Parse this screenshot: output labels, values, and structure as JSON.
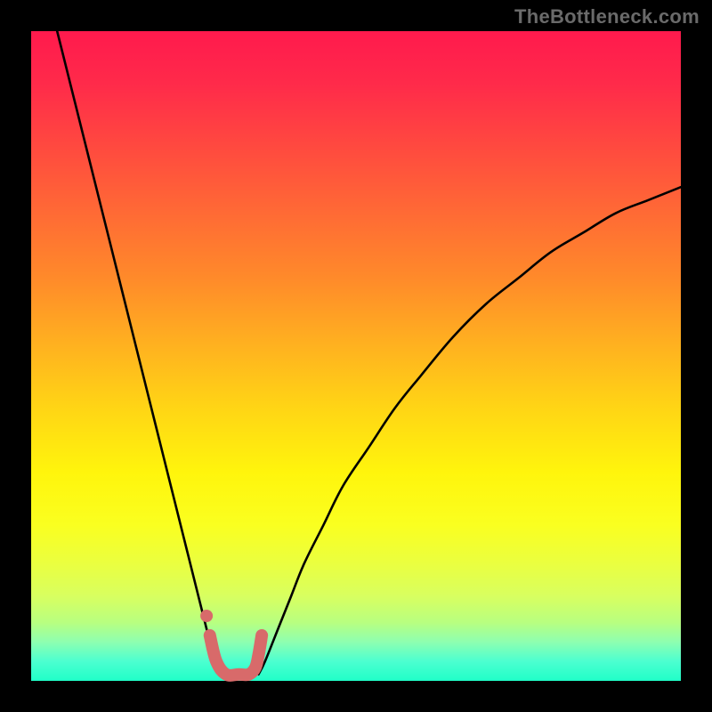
{
  "watermark": "TheBottleneck.com",
  "colors": {
    "frame": "#000000",
    "curve": "#000000",
    "marker": "#d86a6a",
    "gradient_top": "#ff1a4d",
    "gradient_bottom": "#20ffc8"
  },
  "chart_data": {
    "type": "line",
    "title": "",
    "xlabel": "",
    "ylabel": "",
    "xlim": [
      0,
      100
    ],
    "ylim": [
      0,
      100
    ],
    "series": [
      {
        "name": "left-curve",
        "x": [
          4,
          6,
          8,
          10,
          12,
          14,
          16,
          18,
          20,
          22,
          24,
          26,
          27,
          28,
          29
        ],
        "y": [
          100,
          92,
          84,
          76,
          68,
          60,
          52,
          44,
          36,
          28,
          20,
          12,
          8,
          4,
          1
        ]
      },
      {
        "name": "right-curve",
        "x": [
          35,
          36,
          38,
          40,
          42,
          45,
          48,
          52,
          56,
          60,
          65,
          70,
          75,
          80,
          85,
          90,
          95,
          100
        ],
        "y": [
          1,
          3,
          8,
          13,
          18,
          24,
          30,
          36,
          42,
          47,
          53,
          58,
          62,
          66,
          69,
          72,
          74,
          76
        ]
      },
      {
        "name": "marker-segment",
        "x": [
          27.5,
          28.5,
          30,
          32,
          33.5,
          34.5,
          35,
          35.5
        ],
        "y": [
          7,
          3,
          1,
          1,
          1,
          2,
          4,
          7
        ]
      }
    ],
    "marker_dot": {
      "x": 27,
      "y": 10
    },
    "annotations": []
  }
}
